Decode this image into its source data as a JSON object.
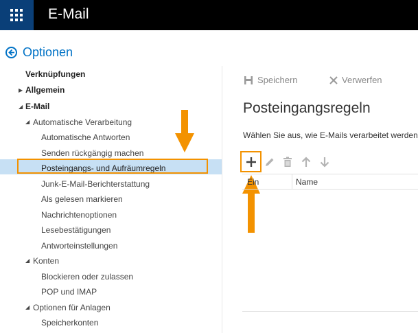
{
  "header": {
    "app_title": "E-Mail"
  },
  "back": {
    "label": "Optionen"
  },
  "nav": {
    "verknuepfungen": "Verknüpfungen",
    "allgemein": "Allgemein",
    "email": "E-Mail",
    "automatische_verarbeitung": "Automatische Verarbeitung",
    "automatische_antworten": "Automatische Antworten",
    "senden_rueckgaengig": "Senden rückgängig machen",
    "posteingangsregeln": "Posteingangs- und Aufräumregeln",
    "junk": "Junk-E-Mail-Berichterstattung",
    "als_gelesen": "Als gelesen markieren",
    "nachrichtenoptionen": "Nachrichtenoptionen",
    "lesebestaetigungen": "Lesebestätigungen",
    "antworteinstellungen": "Antworteinstellungen",
    "konten": "Konten",
    "blockieren": "Blockieren oder zulassen",
    "pop_imap": "POP und IMAP",
    "optionen_anlagen": "Optionen für Anlagen",
    "speicherkonten": "Speicherkonten"
  },
  "toolbar": {
    "save": "Speichern",
    "discard": "Verwerfen"
  },
  "main": {
    "title": "Posteingangsregeln",
    "description": "Wählen Sie aus, wie E-Mails verarbeitet werden.",
    "columns": [
      "Ein",
      "Name"
    ]
  },
  "colors": {
    "accent": "#0072c6",
    "highlight": "#f39200",
    "selection": "#c7e0f4"
  }
}
